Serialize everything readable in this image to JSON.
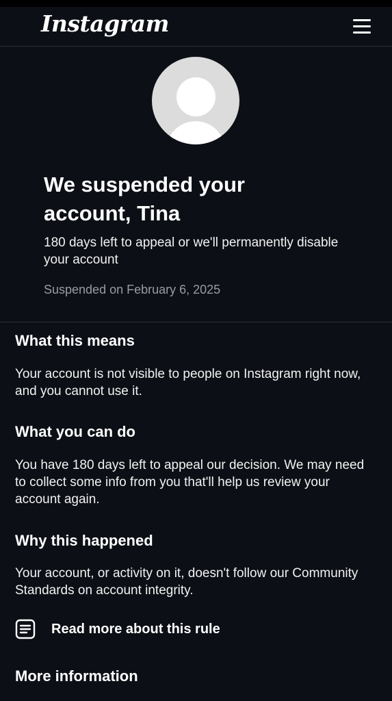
{
  "header": {
    "logo_text": "Instagram",
    "menu_icon": "hamburger-menu-icon"
  },
  "profile": {
    "avatar_icon": "default-avatar-icon"
  },
  "suspension": {
    "title": "We suspended your account, Tina",
    "subtitle": "180 days left to appeal or we'll permanently disable your account",
    "date": "Suspended on February 6, 2025"
  },
  "sections": {
    "what_this_means": {
      "heading": "What this means",
      "body": "Your account is not visible to people on Instagram right now, and you cannot use it."
    },
    "what_you_can_do": {
      "heading": "What you can do",
      "body": "You have 180 days left to appeal our decision. We may need to collect some info from you that'll help us review your account again."
    },
    "why_this_happened": {
      "heading": "Why this happened",
      "body": "Your account, or activity on it, doesn't follow our Community Standards on account integrity."
    },
    "read_more": {
      "label": "Read more about this rule",
      "icon": "document-icon"
    },
    "more_information": {
      "heading": "More information"
    }
  }
}
